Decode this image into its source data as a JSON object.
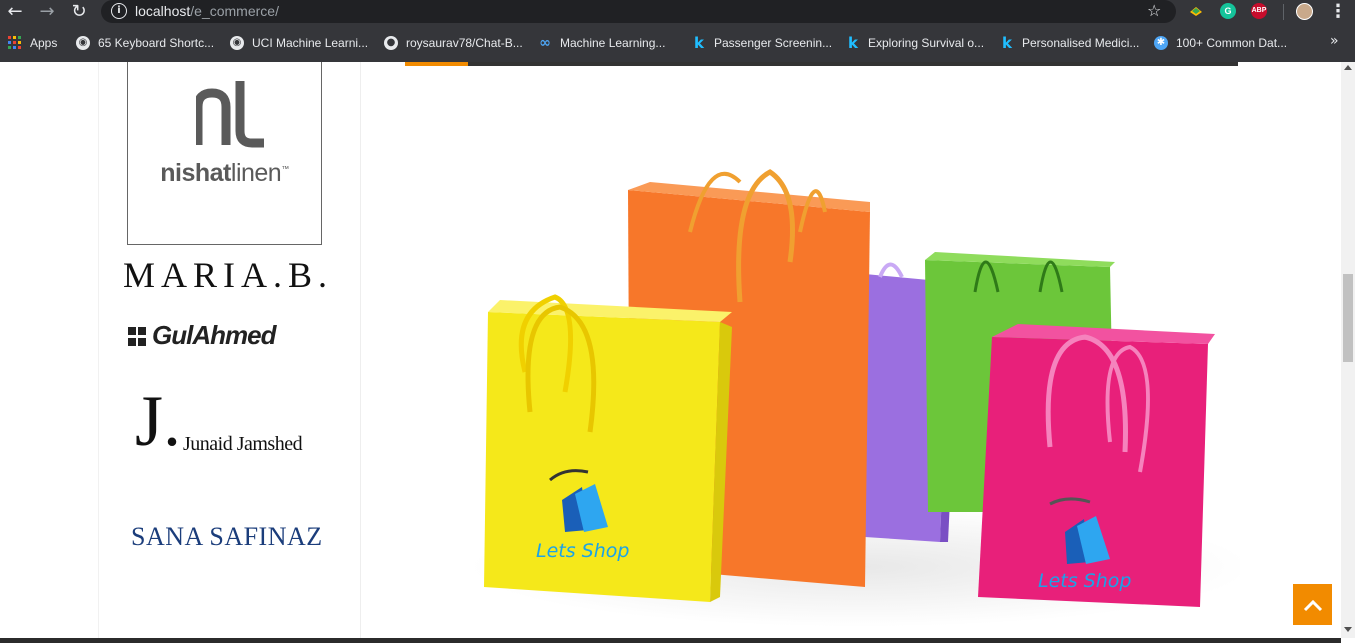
{
  "browser": {
    "url_host": "localhost",
    "url_path": "/e_commerce/",
    "icons": {
      "back": "back-arrow-icon",
      "forward": "forward-arrow-icon",
      "reload": "reload-icon",
      "info": "info-icon",
      "star": "star-icon",
      "menu": "kebab-menu-icon"
    },
    "extensions": [
      {
        "name": "extension-icon",
        "label": ""
      },
      {
        "name": "grammarly-icon",
        "label": "G",
        "color": "#15c39a"
      },
      {
        "name": "adblock-plus-icon",
        "label": "ABP",
        "color": "#c70d2c"
      }
    ]
  },
  "bookmarks": {
    "apps_label": "Apps",
    "items": [
      {
        "label": "65 Keyboard Shortc...",
        "icon": "globe-icon"
      },
      {
        "label": "UCI Machine Learni...",
        "icon": "globe-icon"
      },
      {
        "label": "roysaurav78/Chat-B...",
        "icon": "github-icon"
      },
      {
        "label": "Machine Learning...",
        "icon": "infinity-icon"
      },
      {
        "label": "Passenger Screenin...",
        "icon": "kaggle-icon"
      },
      {
        "label": "Exploring Survival o...",
        "icon": "kaggle-icon"
      },
      {
        "label": "Personalised Medici...",
        "icon": "kaggle-icon"
      },
      {
        "label": "100+ Common Dat...",
        "icon": "settings-icon"
      }
    ],
    "more": "»"
  },
  "sidebar": {
    "brands": {
      "nishat_a": "nishat",
      "nishat_b": "linen",
      "nishat_tm": "™",
      "maria": "MARIA.B.",
      "gulahmed": "GulAhmed",
      "jj_letter": "J.",
      "jj_name": "Junaid Jamshed",
      "sana": "SANA SAFINAZ"
    }
  },
  "hero": {
    "bag_text_left": "Lets Shop",
    "bag_text_right": "Lets Shop",
    "colors": {
      "yellow": "#f5e81a",
      "orange": "#f7772a",
      "purple": "#9b6fe0",
      "green": "#6cc63a",
      "pink": "#e8207a",
      "text": "#1aa3e8"
    }
  },
  "theme": {
    "accent": "#f28b00"
  },
  "back_to_top_icon": "chevron-up-icon"
}
